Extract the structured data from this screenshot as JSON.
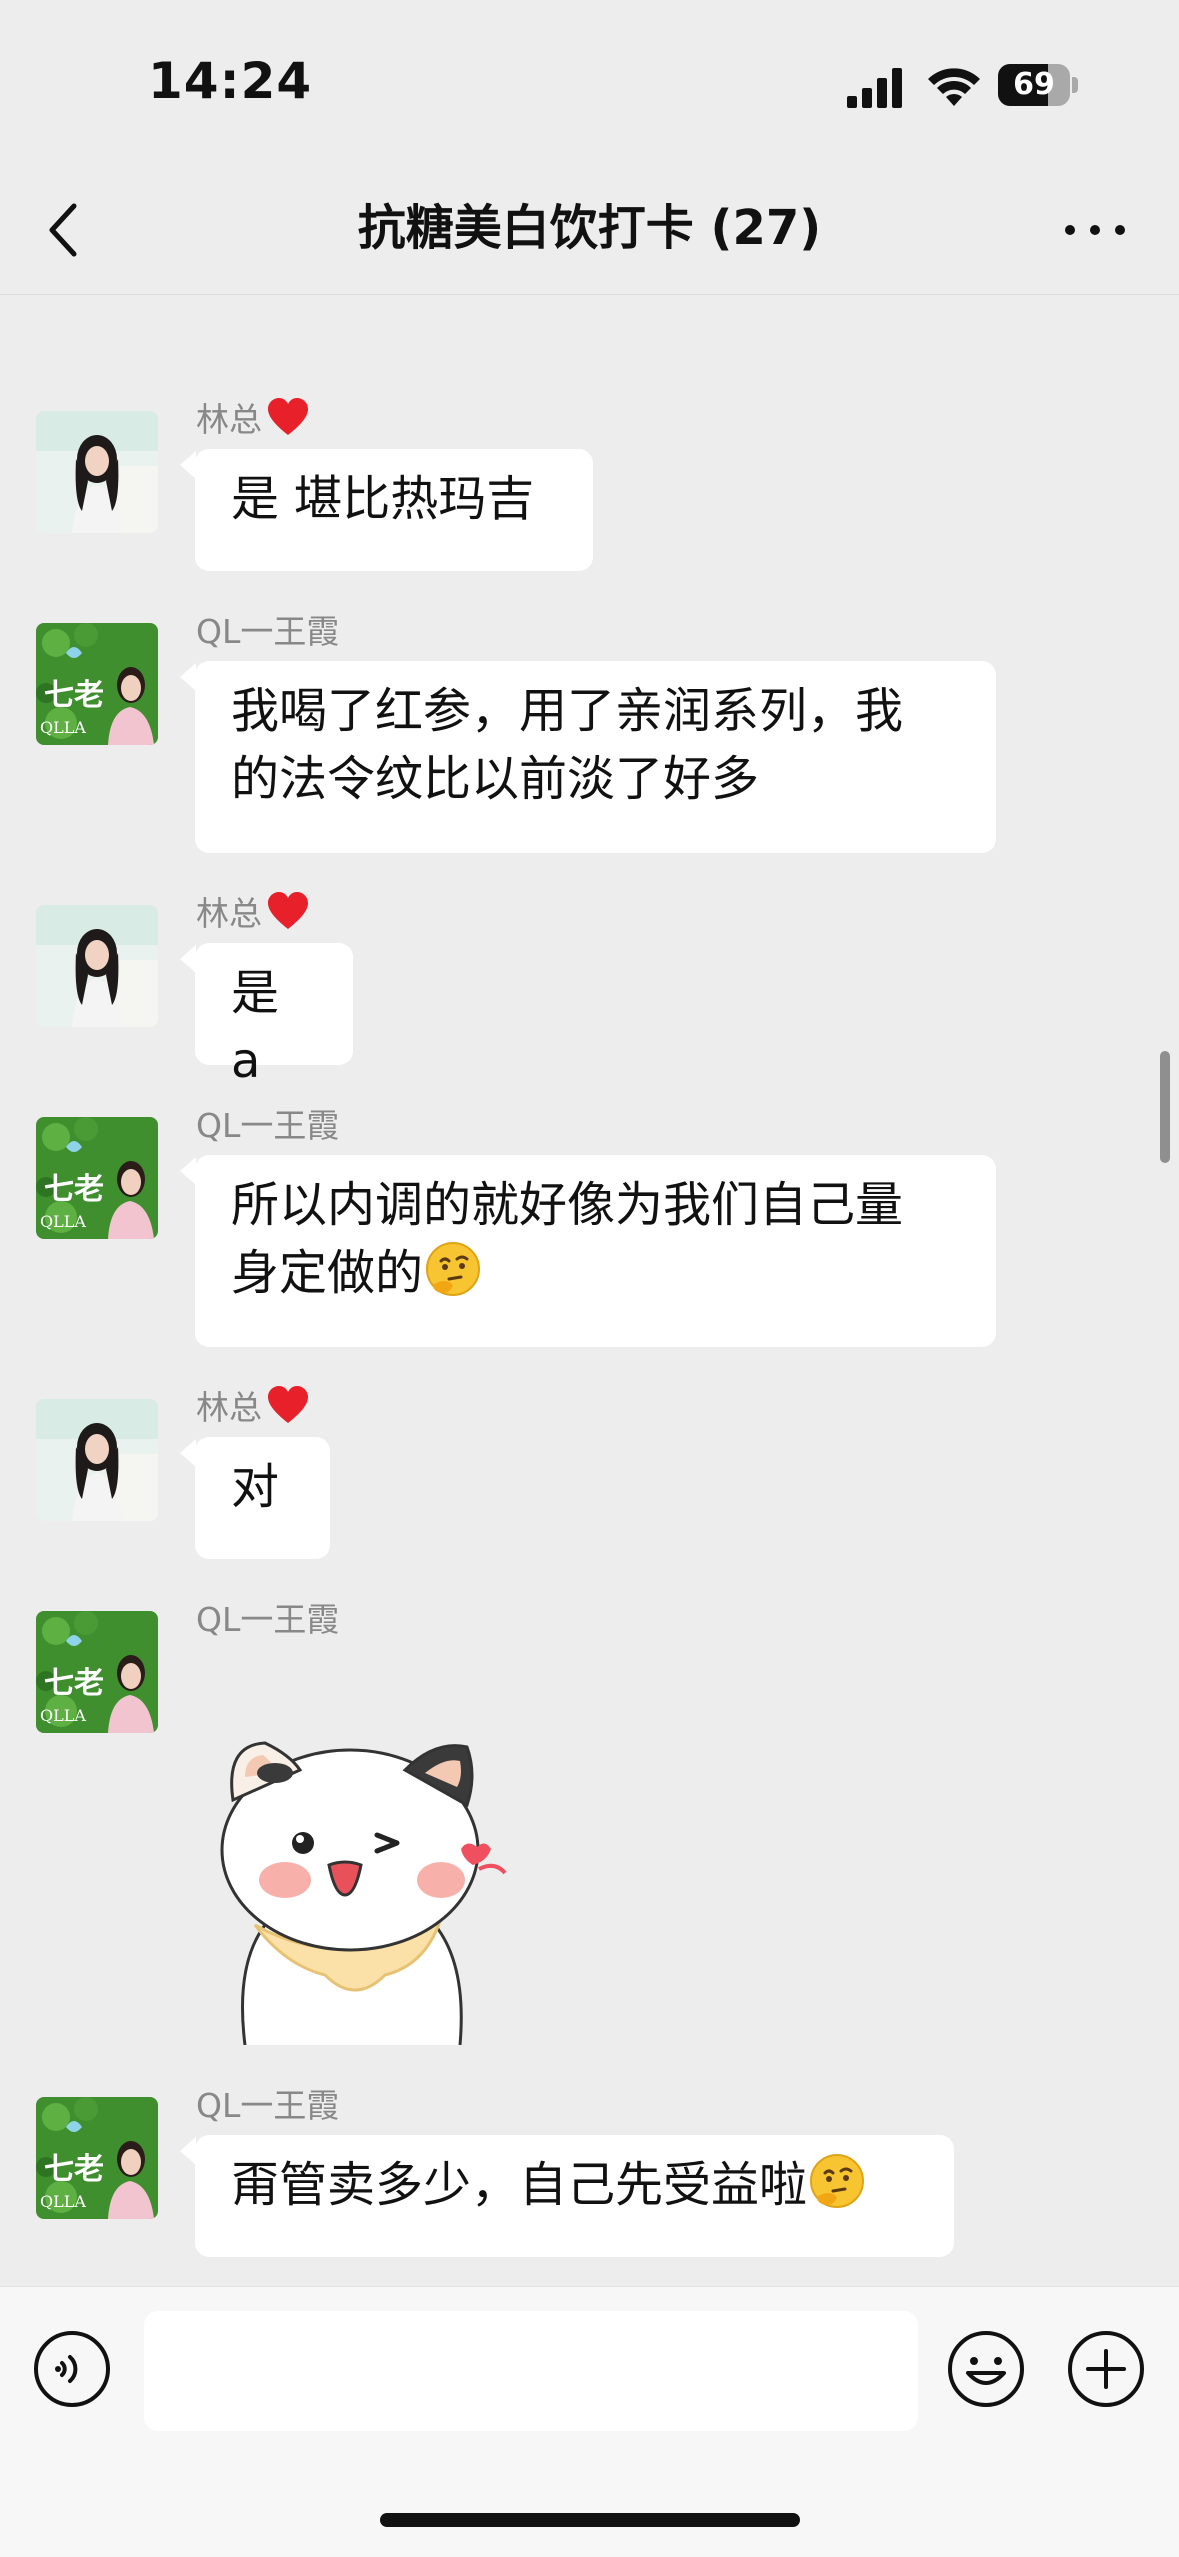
{
  "status_bar": {
    "time": "14:24",
    "battery_percent": "69",
    "battery_level": 0.69
  },
  "nav": {
    "title": "抗糖美白饮打卡 (27)"
  },
  "messages": [
    {
      "sender": "林总",
      "sender_heart": true,
      "text": "是 堪比热玛吉"
    },
    {
      "sender": "QL一王霞",
      "sender_heart": false,
      "text_lines": [
        "我喝了红参，用了亲润系列，我",
        "的法令纹比以前淡了好多"
      ]
    },
    {
      "sender": "林总",
      "sender_heart": true,
      "text": "是 a"
    },
    {
      "sender": "QL一王霞",
      "sender_heart": false,
      "text_lines": [
        "所以内调的就好像为我们自己量",
        "身定做的"
      ],
      "emoji": "thinking-face"
    },
    {
      "sender": "林总",
      "sender_heart": true,
      "text": "对"
    },
    {
      "sender": "QL一王霞",
      "sender_heart": false,
      "sticker": "winking-cat-sticker"
    },
    {
      "sender": "QL一王霞",
      "sender_heart": false,
      "text": "甭管卖多少，自己先受益啦",
      "emoji": "thinking-face"
    }
  ],
  "avatars": {
    "lin": {
      "logo": "",
      "colors": [
        "#e8f1ee",
        "#cfe3dd"
      ]
    },
    "wang": {
      "logo_text": "七老",
      "logo_sub": "QLLA",
      "colors": [
        "#2f7d2a",
        "#5aa63f"
      ]
    }
  },
  "input_bar": {
    "placeholder": ""
  },
  "colors": {
    "background": "#ededed",
    "bubble": "#ffffff",
    "accent_heart": "#e8202a"
  }
}
